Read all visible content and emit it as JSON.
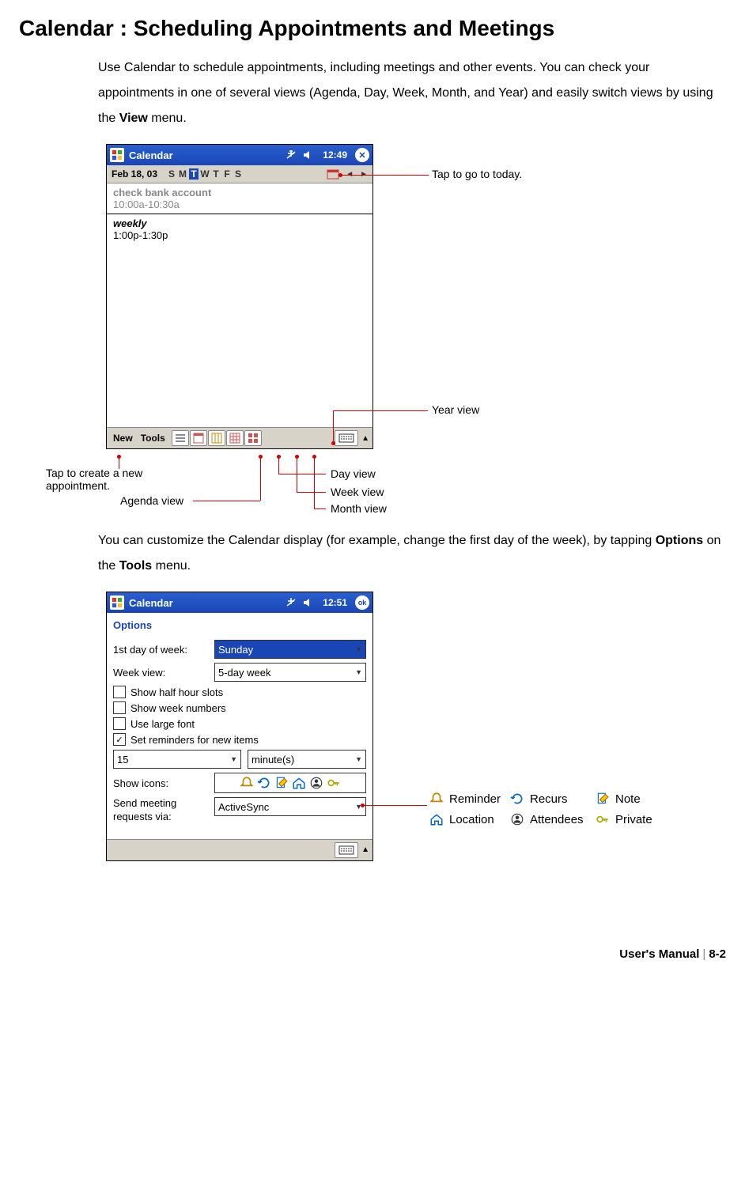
{
  "page": {
    "heading": "Calendar : Scheduling Appointments and Meetings",
    "intro_pre": "Use Calendar to schedule appointments, including meetings and other events. You can check your appointments in one of several views (Agenda, Day, Week, Month, and Year) and easily switch views by using the ",
    "intro_bold": "View",
    "intro_post": " menu.",
    "intro2_pre": "You can customize the Calendar display (for example, change the first day of the week), by tapping ",
    "intro2_bold1": "Options",
    "intro2_mid": " on the ",
    "intro2_bold2": "Tools",
    "intro2_post": " menu.",
    "footer_left": "User's Manual",
    "footer_right": "8-2"
  },
  "callouts1": {
    "today": "Tap to go to today.",
    "year": "Year view",
    "day": "Day view",
    "week": "Week view",
    "month": "Month view",
    "agenda": "Agenda view",
    "new": "Tap to create a new appointment."
  },
  "shot1": {
    "title": "Calendar",
    "time": "12:49",
    "date": "Feb 18, 03",
    "days": [
      "S",
      "M",
      "T",
      "W",
      "T",
      "F",
      "S"
    ],
    "days_selected_index": 2,
    "entry_past_title": "check bank account",
    "entry_past_time": "10:00a-10:30a",
    "entry_now_title": "weekly",
    "entry_now_time": "1:00p-1:30p",
    "menu_new": "New",
    "menu_tools": "Tools"
  },
  "shot2": {
    "title": "Calendar",
    "time": "12:51",
    "screen_title": "Options",
    "first_day_label": "1st day of week:",
    "first_day_value": "Sunday",
    "week_view_label": "Week view:",
    "week_view_value": "5-day week",
    "chk_half": "Show half hour slots",
    "chk_weeknum": "Show week numbers",
    "chk_large": "Use large font",
    "chk_reminders": "Set reminders for new items",
    "reminder_value": "15",
    "reminder_unit": "minute(s)",
    "show_icons_label": "Show icons:",
    "send_label": "Send meeting requests via:",
    "send_value": "ActiveSync"
  },
  "legend": {
    "reminder": "Reminder",
    "recurs": "Recurs",
    "note": "Note",
    "location": "Location",
    "attendees": "Attendees",
    "private": "Private"
  }
}
